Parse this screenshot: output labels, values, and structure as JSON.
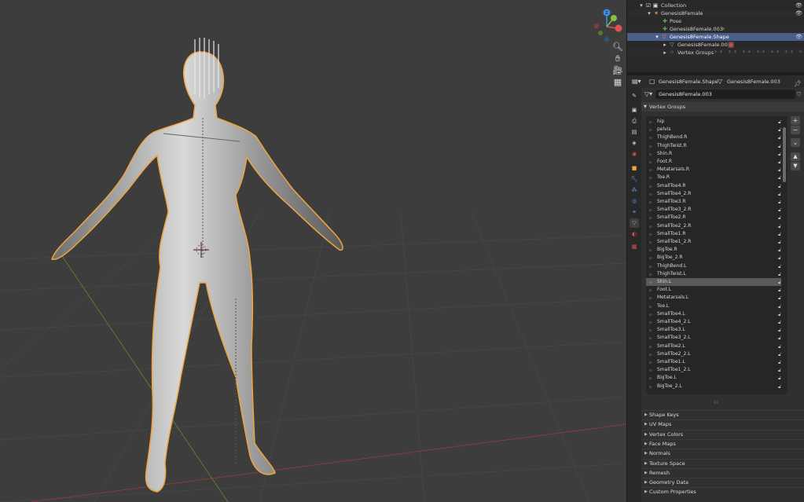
{
  "outliner": {
    "rows": [
      {
        "label": "Collection",
        "icon": "collection-icon"
      },
      {
        "label": "Genesis8Female",
        "icon": "armature-icon"
      },
      {
        "label": "Pose",
        "icon": "pose-icon"
      },
      {
        "label": "Genesis8Female.003",
        "icon": "bone-icon"
      },
      {
        "label": "Genesis8Female.Shape",
        "icon": "mesh-object-icon"
      },
      {
        "label": "Genesis8Female.003",
        "icon": "mesh-data-icon"
      },
      {
        "label": "Vertex Groups",
        "icon": "vertex-groups-icon"
      }
    ]
  },
  "properties": {
    "breadcrumb_object": "Genesis8Female.Shape",
    "breadcrumb_mesh": "Genesis8Female.003",
    "mesh_name": "Genesis8Female.003",
    "vertex_groups_title": "Vertex Groups",
    "vertex_groups": [
      "hip",
      "pelvis",
      "ThighBend.R",
      "ThighTwist.R",
      "Shin.R",
      "Foot.R",
      "Metatarsals.R",
      "Toe.R",
      "SmallToe4.R",
      "SmallToe4_2.R",
      "SmallToe3.R",
      "SmallToe3_2.R",
      "SmallToe2.R",
      "SmallToe2_2.R",
      "SmallToe1.R",
      "SmallToe1_2.R",
      "BigToe.R",
      "BigToe_2.R",
      "ThighBend.L",
      "ThighTwist.L",
      "Shin.L",
      "Foot.L",
      "Metatarsals.L",
      "Toe.L",
      "SmallToe4.L",
      "SmallToe4_2.L",
      "SmallToe3.L",
      "SmallToe3_2.L",
      "SmallToe2.L",
      "SmallToe2_2.L",
      "SmallToe1.L",
      "SmallToe1_2.L",
      "BigToe.L",
      "BigToe_2.L"
    ],
    "selected_group": "Shin.L",
    "collapsed_panels": [
      "Shape Keys",
      "UV Maps",
      "Vertex Colors",
      "Face Maps",
      "Normals",
      "Texture Space",
      "Remesh",
      "Geometry Data",
      "Custom Properties"
    ]
  },
  "gizmo": {
    "z": "Z",
    "x": "X",
    "y": "Y"
  },
  "colors": {
    "selection_outline": "#f2a33c",
    "x_axis": "#e05050",
    "y_axis": "#88c040",
    "z_axis": "#3a8ee6",
    "outliner_selected": "#4a5e8a"
  }
}
